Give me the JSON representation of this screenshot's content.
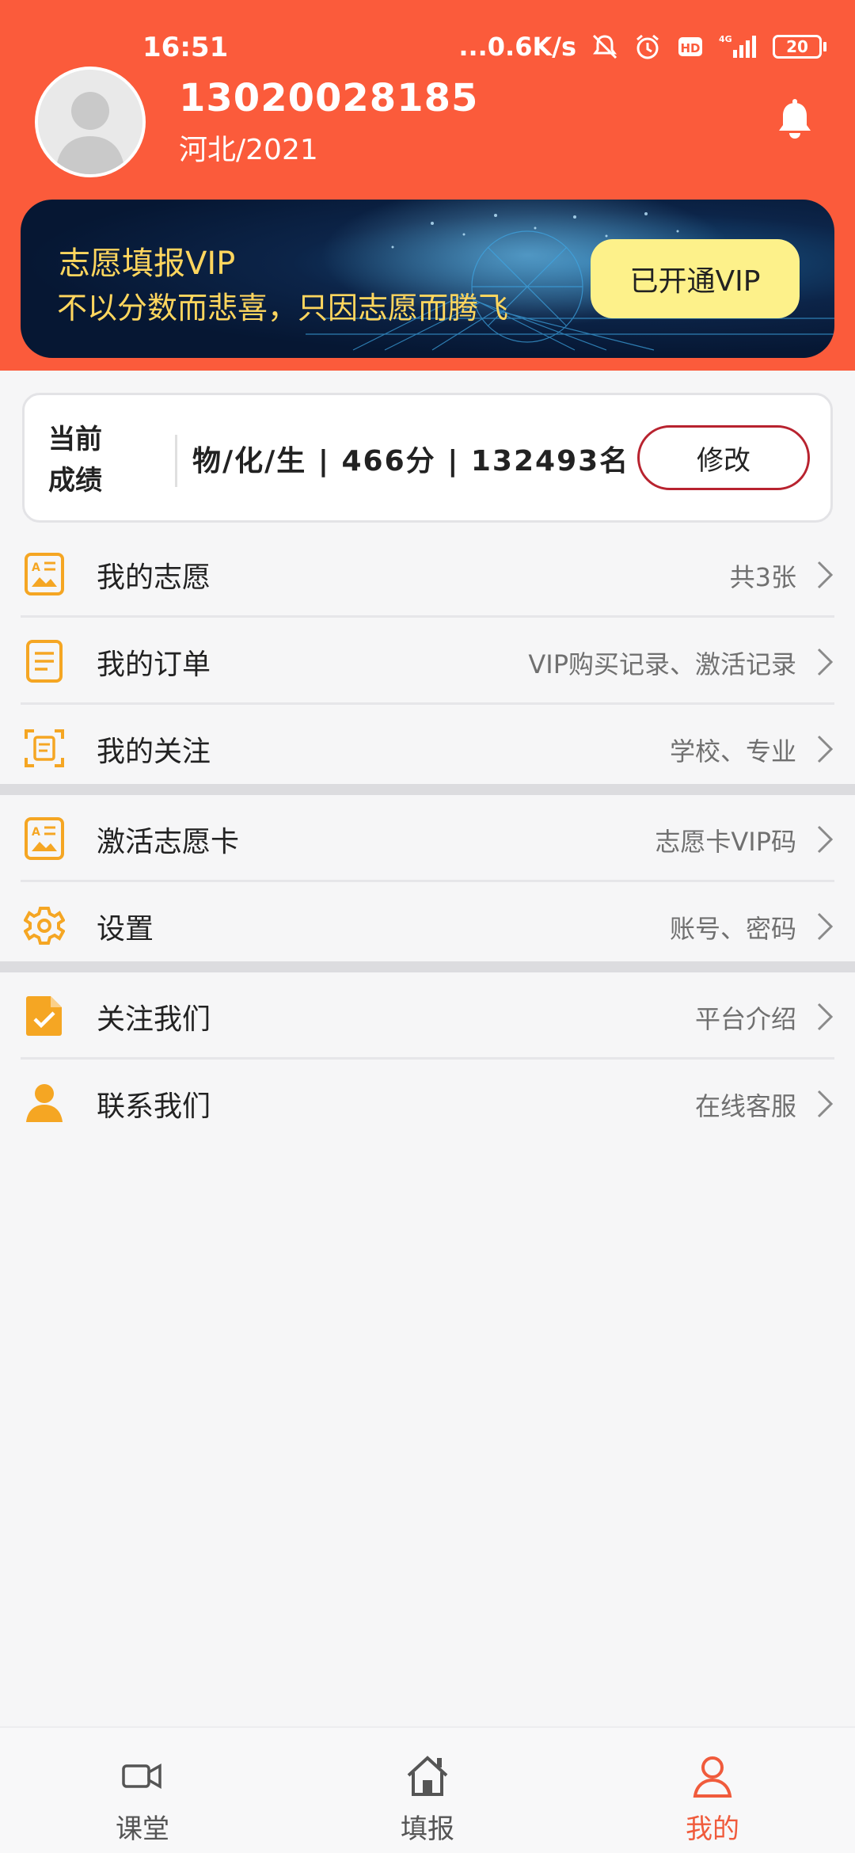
{
  "status_bar": {
    "time": "16:51",
    "network_speed": "...0.6K/s",
    "battery": "20",
    "icons": [
      "mute-bell-icon",
      "alarm-icon",
      "hd-icon",
      "4g-signal-icon",
      "battery-icon"
    ]
  },
  "profile": {
    "phone": "13020028185",
    "region": "河北/2021",
    "avatar_icon": "avatar-placeholder-icon",
    "bell_icon": "bell-icon"
  },
  "vip_banner": {
    "title": "志愿填报VIP",
    "slogan": "不以分数而悲喜，只因志愿而腾飞",
    "button_label": "已开通VIP"
  },
  "score": {
    "label": "当前成绩",
    "label_line1": "当前",
    "label_line2": "成绩",
    "value": "物/化/生 | 466分 | 132493名",
    "modify_label": "修改"
  },
  "menu_groups": [
    {
      "items": [
        {
          "label": "我的志愿",
          "hint": "共3张",
          "icon": "volunteer-card-icon"
        },
        {
          "label": "我的订单",
          "hint": "VIP购买记录、激活记录",
          "icon": "order-document-icon"
        },
        {
          "label": "我的关注",
          "hint": "学校、专业",
          "icon": "follow-scan-icon"
        }
      ]
    },
    {
      "items": [
        {
          "label": "激活志愿卡",
          "hint": "志愿卡VIP码",
          "icon": "activate-card-icon"
        },
        {
          "label": "设置",
          "hint": "账号、密码",
          "icon": "gear-icon"
        }
      ]
    },
    {
      "items": [
        {
          "label": "关注我们",
          "hint": "平台介绍",
          "icon": "checked-file-icon"
        },
        {
          "label": "联系我们",
          "hint": "在线客服",
          "icon": "person-icon"
        }
      ]
    }
  ],
  "tabbar": {
    "tabs": [
      {
        "label": "课堂",
        "icon": "video-camera-icon",
        "active": false
      },
      {
        "label": "填报",
        "icon": "home-icon",
        "active": false
      },
      {
        "label": "我的",
        "icon": "user-icon",
        "active": true
      }
    ]
  },
  "colors": {
    "header": "#fb5b3b",
    "vip_gold": "#ffd65e",
    "vip_button": "#fdf18a",
    "menu_icon": "#f5a623",
    "active_tab": "#f05b3c",
    "modify_border": "#b8232f"
  }
}
